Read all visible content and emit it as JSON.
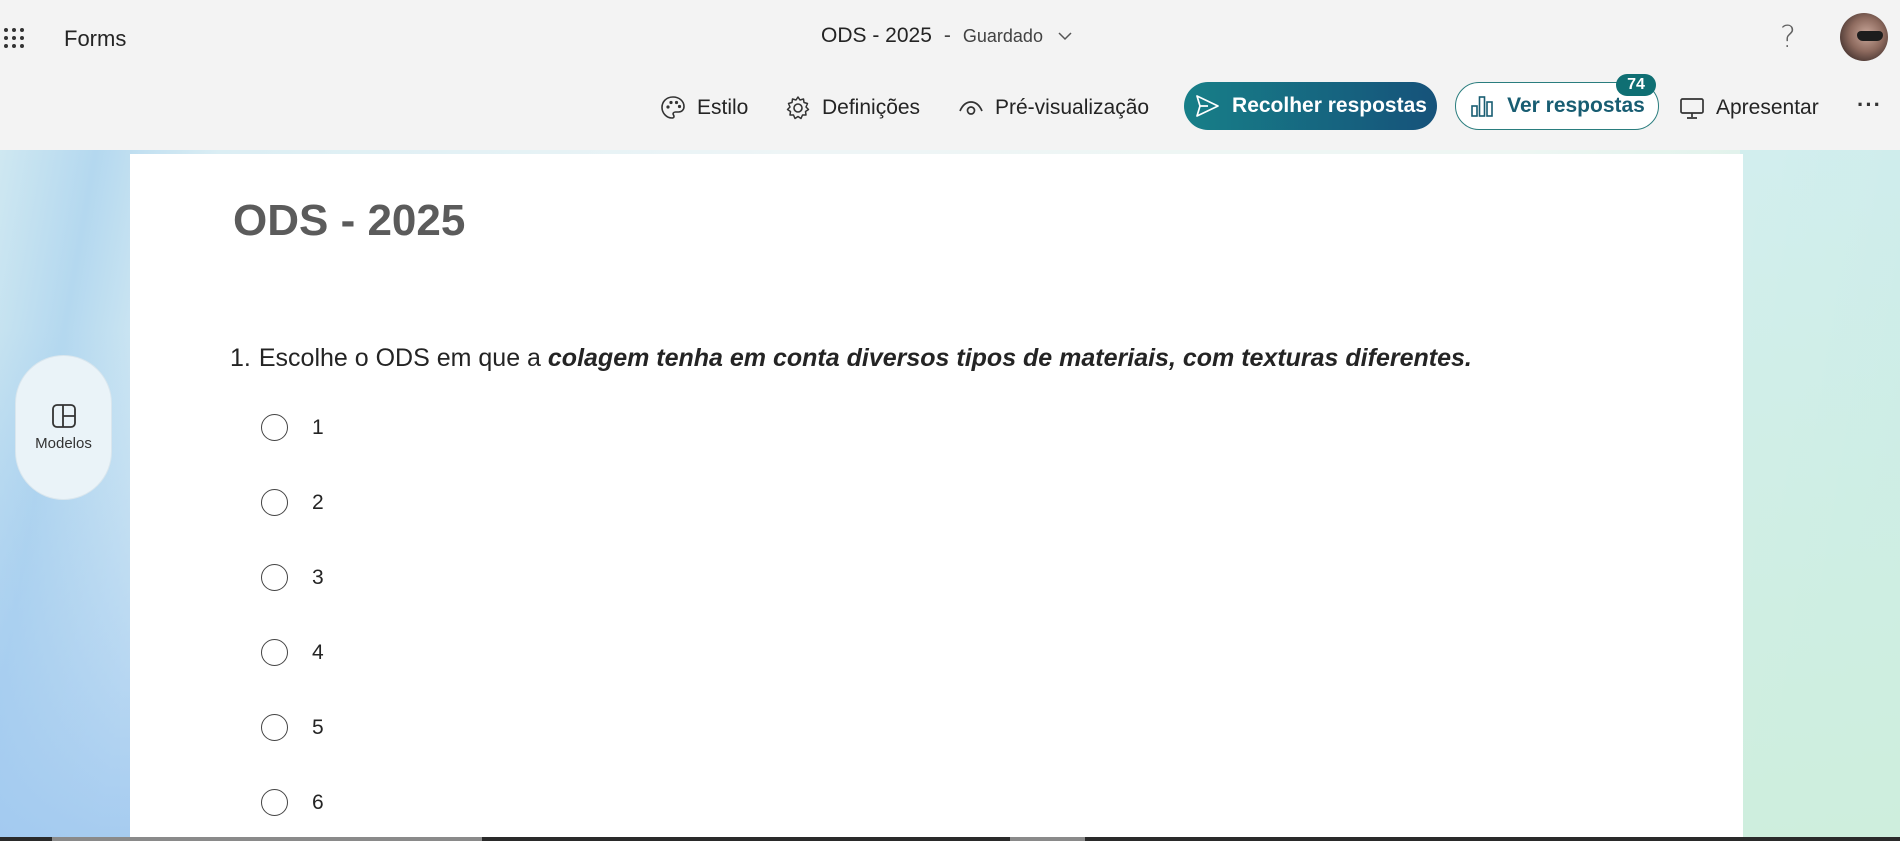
{
  "header": {
    "app_name": "Forms",
    "doc_title": "ODS - 2025",
    "separator": "-",
    "save_status": "Guardado",
    "help_label": "?"
  },
  "toolbar": {
    "style_label": "Estilo",
    "settings_label": "Definições",
    "preview_label": "Pré-visualização",
    "collect_label": "Recolher respostas",
    "view_label": "Ver respostas",
    "responses_count": "74",
    "present_label": "Apresentar",
    "more_label": "···"
  },
  "sidebar": {
    "models_label": "Modelos"
  },
  "form": {
    "title": "ODS - 2025",
    "question": {
      "number": "1.",
      "text_plain": "Escolhe o ODS em que a ",
      "text_emphasis": "colagem tenha em conta diversos tipos de materiais, com texturas diferentes."
    },
    "options": [
      "1",
      "2",
      "3",
      "4",
      "5",
      "6"
    ]
  },
  "colors": {
    "collect_gradient_start": "#177f88",
    "collect_gradient_end": "#16527a",
    "view_border": "#2a7d7e",
    "badge_bg": "#0f6f73"
  }
}
